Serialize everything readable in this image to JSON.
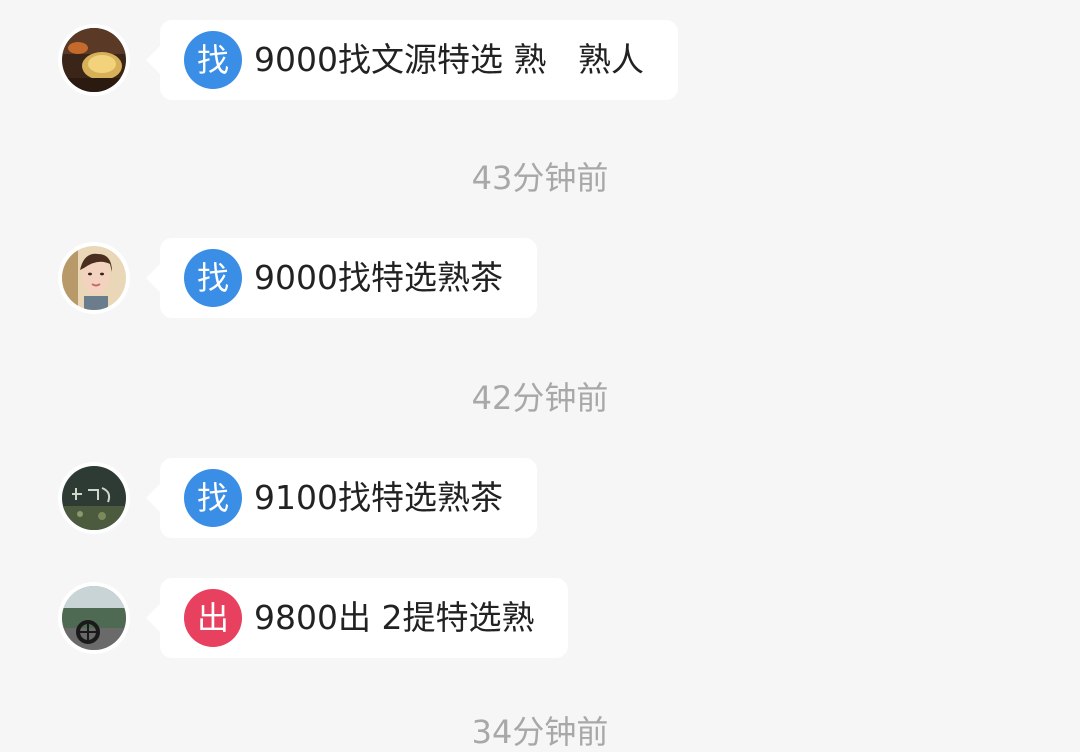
{
  "messages": [
    {
      "avatar": "tea-cup-avatar",
      "tag": "找",
      "tag_type": "find",
      "text": "9000找文源特选 熟   熟人"
    },
    {
      "avatar": "woman-portrait-avatar",
      "tag": "找",
      "tag_type": "find",
      "text": "9000找特选熟茶"
    },
    {
      "avatar": "dark-calligraphy-avatar",
      "tag": "找",
      "tag_type": "find",
      "text": "9100找特选熟茶"
    },
    {
      "avatar": "street-photo-avatar",
      "tag": "出",
      "tag_type": "sell",
      "text": "9800出 2提特选熟"
    }
  ],
  "timestamps": [
    "43分钟前",
    "42分钟前",
    "34分钟前"
  ],
  "colors": {
    "background": "#f6f6f6",
    "bubble": "#ffffff",
    "find_badge": "#3a8ee6",
    "sell_badge": "#e8405f",
    "timestamp_text": "#a8a8a8",
    "message_text": "#222222"
  }
}
